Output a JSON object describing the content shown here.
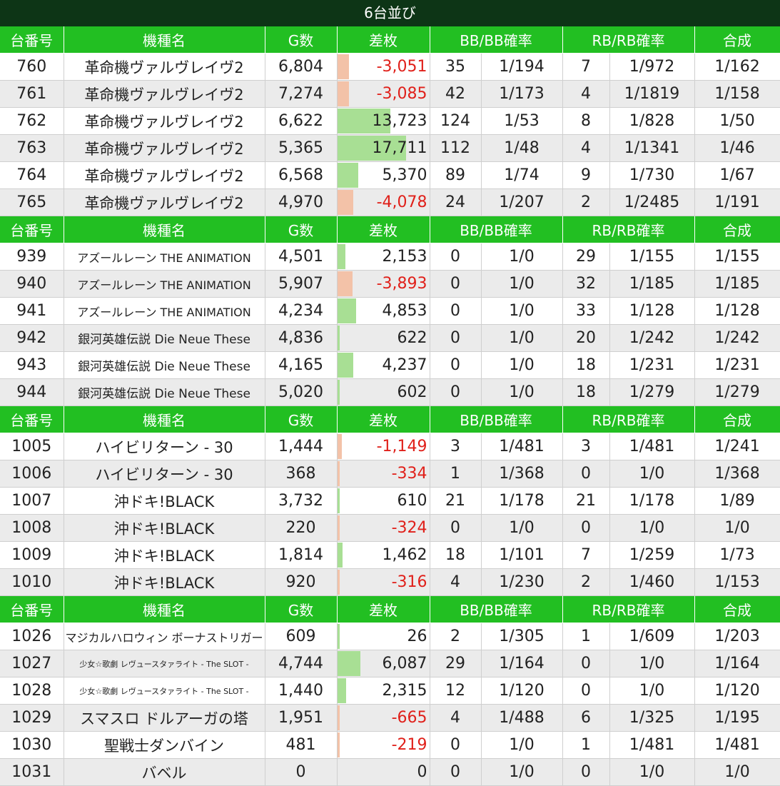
{
  "title": "6台並び",
  "headers": [
    "台番号",
    "機種名",
    "G数",
    "差枚",
    "BB/BB確率",
    "RB/RB確率",
    "合成"
  ],
  "colors": {
    "header_bg": "#22bf22",
    "title_bg": "#0d3516",
    "positive_bar": "#a8df94",
    "negative_bar": "#f3c2a8",
    "negative_text": "#e0201a"
  },
  "diff_scale_max": 17711,
  "sections": [
    {
      "rows": [
        {
          "no": "760",
          "name": "革命機ヴァルヴレイヴ2",
          "g": "6,804",
          "diff": "-3,051",
          "diff_value": -3051,
          "bb": "35",
          "bb_rate": "1/194",
          "rb": "7",
          "rb_rate": "1/972",
          "combined": "1/162"
        },
        {
          "no": "761",
          "name": "革命機ヴァルヴレイヴ2",
          "g": "7,274",
          "diff": "-3,085",
          "diff_value": -3085,
          "bb": "42",
          "bb_rate": "1/173",
          "rb": "4",
          "rb_rate": "1/1819",
          "combined": "1/158"
        },
        {
          "no": "762",
          "name": "革命機ヴァルヴレイヴ2",
          "g": "6,622",
          "diff": "13,723",
          "diff_value": 13723,
          "bb": "124",
          "bb_rate": "1/53",
          "rb": "8",
          "rb_rate": "1/828",
          "combined": "1/50"
        },
        {
          "no": "763",
          "name": "革命機ヴァルヴレイヴ2",
          "g": "5,365",
          "diff": "17,711",
          "diff_value": 17711,
          "bb": "112",
          "bb_rate": "1/48",
          "rb": "4",
          "rb_rate": "1/1341",
          "combined": "1/46"
        },
        {
          "no": "764",
          "name": "革命機ヴァルヴレイヴ2",
          "g": "6,568",
          "diff": "5,370",
          "diff_value": 5370,
          "bb": "89",
          "bb_rate": "1/74",
          "rb": "9",
          "rb_rate": "1/730",
          "combined": "1/67"
        },
        {
          "no": "765",
          "name": "革命機ヴァルヴレイヴ2",
          "g": "4,970",
          "diff": "-4,078",
          "diff_value": -4078,
          "bb": "24",
          "bb_rate": "1/207",
          "rb": "2",
          "rb_rate": "1/2485",
          "combined": "1/191"
        }
      ]
    },
    {
      "rows": [
        {
          "no": "939",
          "name": "アズールレーン THE ANIMATION",
          "g": "4,501",
          "diff": "2,153",
          "diff_value": 2153,
          "bb": "0",
          "bb_rate": "1/0",
          "rb": "29",
          "rb_rate": "1/155",
          "combined": "1/155"
        },
        {
          "no": "940",
          "name": "アズールレーン THE ANIMATION",
          "g": "5,907",
          "diff": "-3,893",
          "diff_value": -3893,
          "bb": "0",
          "bb_rate": "1/0",
          "rb": "32",
          "rb_rate": "1/185",
          "combined": "1/185"
        },
        {
          "no": "941",
          "name": "アズールレーン THE ANIMATION",
          "g": "4,234",
          "diff": "4,853",
          "diff_value": 4853,
          "bb": "0",
          "bb_rate": "1/0",
          "rb": "33",
          "rb_rate": "1/128",
          "combined": "1/128"
        },
        {
          "no": "942",
          "name": "銀河英雄伝説 Die Neue These",
          "g": "4,836",
          "diff": "622",
          "diff_value": 622,
          "bb": "0",
          "bb_rate": "1/0",
          "rb": "20",
          "rb_rate": "1/242",
          "combined": "1/242"
        },
        {
          "no": "943",
          "name": "銀河英雄伝説 Die Neue These",
          "g": "4,165",
          "diff": "4,237",
          "diff_value": 4237,
          "bb": "0",
          "bb_rate": "1/0",
          "rb": "18",
          "rb_rate": "1/231",
          "combined": "1/231"
        },
        {
          "no": "944",
          "name": "銀河英雄伝説 Die Neue These",
          "g": "5,020",
          "diff": "602",
          "diff_value": 602,
          "bb": "0",
          "bb_rate": "1/0",
          "rb": "18",
          "rb_rate": "1/279",
          "combined": "1/279"
        }
      ]
    },
    {
      "rows": [
        {
          "no": "1005",
          "name": "ハイビリターン - 30",
          "g": "1,444",
          "diff": "-1,149",
          "diff_value": -1149,
          "bb": "3",
          "bb_rate": "1/481",
          "rb": "3",
          "rb_rate": "1/481",
          "combined": "1/241"
        },
        {
          "no": "1006",
          "name": "ハイビリターン - 30",
          "g": "368",
          "diff": "-334",
          "diff_value": -334,
          "bb": "1",
          "bb_rate": "1/368",
          "rb": "0",
          "rb_rate": "1/0",
          "combined": "1/368"
        },
        {
          "no": "1007",
          "name": "沖ドキ!BLACK",
          "g": "3,732",
          "diff": "610",
          "diff_value": 610,
          "bb": "21",
          "bb_rate": "1/178",
          "rb": "21",
          "rb_rate": "1/178",
          "combined": "1/89"
        },
        {
          "no": "1008",
          "name": "沖ドキ!BLACK",
          "g": "220",
          "diff": "-324",
          "diff_value": -324,
          "bb": "0",
          "bb_rate": "1/0",
          "rb": "0",
          "rb_rate": "1/0",
          "combined": "1/0"
        },
        {
          "no": "1009",
          "name": "沖ドキ!BLACK",
          "g": "1,814",
          "diff": "1,462",
          "diff_value": 1462,
          "bb": "18",
          "bb_rate": "1/101",
          "rb": "7",
          "rb_rate": "1/259",
          "combined": "1/73"
        },
        {
          "no": "1010",
          "name": "沖ドキ!BLACK",
          "g": "920",
          "diff": "-316",
          "diff_value": -316,
          "bb": "4",
          "bb_rate": "1/230",
          "rb": "2",
          "rb_rate": "1/460",
          "combined": "1/153"
        }
      ]
    },
    {
      "rows": [
        {
          "no": "1026",
          "name": "マジカルハロウィン ボーナストリガー",
          "g": "609",
          "diff": "26",
          "diff_value": 26,
          "bb": "2",
          "bb_rate": "1/305",
          "rb": "1",
          "rb_rate": "1/609",
          "combined": "1/203"
        },
        {
          "no": "1027",
          "name": "少女☆歌劇 レヴュースタァライト - The SLOT -",
          "g": "4,744",
          "diff": "6,087",
          "diff_value": 6087,
          "bb": "29",
          "bb_rate": "1/164",
          "rb": "0",
          "rb_rate": "1/0",
          "combined": "1/164"
        },
        {
          "no": "1028",
          "name": "少女☆歌劇 レヴュースタァライト - The SLOT -",
          "g": "1,440",
          "diff": "2,315",
          "diff_value": 2315,
          "bb": "12",
          "bb_rate": "1/120",
          "rb": "0",
          "rb_rate": "1/0",
          "combined": "1/120"
        },
        {
          "no": "1029",
          "name": "スマスロ ドルアーガの塔",
          "g": "1,951",
          "diff": "-665",
          "diff_value": -665,
          "bb": "4",
          "bb_rate": "1/488",
          "rb": "6",
          "rb_rate": "1/325",
          "combined": "1/195"
        },
        {
          "no": "1030",
          "name": "聖戦士ダンバイン",
          "g": "481",
          "diff": "-219",
          "diff_value": -219,
          "bb": "0",
          "bb_rate": "1/0",
          "rb": "1",
          "rb_rate": "1/481",
          "combined": "1/481"
        },
        {
          "no": "1031",
          "name": "バベル",
          "g": "0",
          "diff": "0",
          "diff_value": 0,
          "bb": "0",
          "bb_rate": "1/0",
          "rb": "0",
          "rb_rate": "1/0",
          "combined": "1/0"
        }
      ]
    }
  ]
}
